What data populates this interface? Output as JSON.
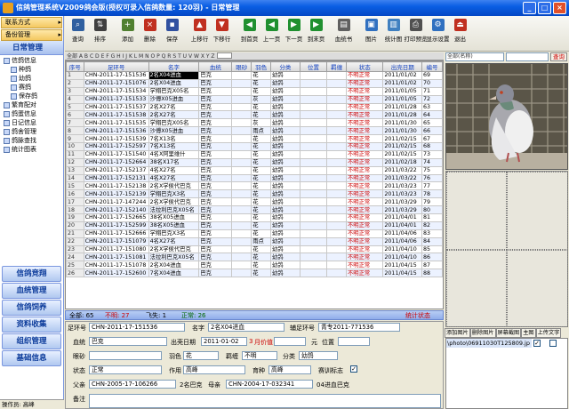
{
  "window": {
    "title": "信鸽管理系统V2009鸽会版(授权可录入信鸽数量: 120羽)  - 日常管理"
  },
  "nav": {
    "top_items": [
      {
        "label": "联系方式",
        "arrow": "▸"
      },
      {
        "label": "备份管理",
        "arrow": "▸"
      }
    ],
    "daily_section": "日常管理",
    "tree": [
      {
        "label": "信鸽信息",
        "sub": false
      },
      {
        "label": "种鸽",
        "sub": true
      },
      {
        "label": "幼鸽",
        "sub": true
      },
      {
        "label": "赛鸽",
        "sub": true
      },
      {
        "label": "保存鸽",
        "sub": true
      },
      {
        "label": "繁育配对",
        "sub": false
      },
      {
        "label": "鸽蛋信息",
        "sub": false
      },
      {
        "label": "日记信息",
        "sub": false
      },
      {
        "label": "鸽舍管理",
        "sub": false
      },
      {
        "label": "鸽脉查找",
        "sub": false
      },
      {
        "label": "统计图表",
        "sub": false
      }
    ],
    "sections": [
      "信鸽竞翔",
      "血统管理",
      "信鸽饲养",
      "资料收集",
      "组织管理",
      "基础信息"
    ],
    "status": "操作员: 高峰"
  },
  "toolbar": {
    "buttons": [
      {
        "label": "查询",
        "icon": "search-icon",
        "color": "#3060a0"
      },
      {
        "label": "排序",
        "icon": "sort-icon",
        "color": "#404040"
      },
      {
        "label": "添加",
        "icon": "add-icon",
        "color": "#508030"
      },
      {
        "label": "删除",
        "icon": "delete-icon",
        "color": "#c03020"
      },
      {
        "label": "保存",
        "icon": "save-icon",
        "color": "#3050a0"
      },
      {
        "label": "上移行",
        "icon": "move-up-icon",
        "color": "#c03020"
      },
      {
        "label": "下移行",
        "icon": "move-down-icon",
        "color": "#c03020"
      },
      {
        "label": "到首页",
        "icon": "first-page-icon",
        "color": "#209030"
      },
      {
        "label": "上一页",
        "icon": "prev-page-icon",
        "color": "#209030"
      },
      {
        "label": "下一页",
        "icon": "next-page-icon",
        "color": "#209030"
      },
      {
        "label": "到末页",
        "icon": "last-page-icon",
        "color": "#209030"
      },
      {
        "label": "血统书",
        "icon": "pedigree-icon",
        "color": "#606060"
      },
      {
        "label": "图片",
        "icon": "picture-icon",
        "color": "#3070c0"
      },
      {
        "label": "统计图",
        "icon": "chart-icon",
        "color": "#4080c0"
      },
      {
        "label": "打印预览",
        "icon": "print-preview-icon",
        "color": "#505050"
      },
      {
        "label": "显示设置",
        "icon": "display-settings-icon",
        "color": "#3070c0"
      },
      {
        "label": "退出",
        "icon": "exit-icon",
        "color": "#c03020"
      }
    ]
  },
  "alpha_bar": {
    "text": "全部 A B C D E F G H I J K L M N O P Q R S T U V W X Y Z"
  },
  "grid": {
    "columns": [
      "序号",
      "足环号",
      "名字",
      "血统",
      "眼砂",
      "羽色",
      "分类",
      "位置",
      "羁缠",
      "状态",
      "出壳日期",
      "编号"
    ],
    "rows": [
      [
        "1",
        "CHN-2011-17-151536",
        "2名X04进血",
        "巴克",
        "",
        "花",
        "幼鸽",
        "",
        "",
        "不明正常",
        "2011/01/02",
        "69"
      ],
      [
        "2",
        "CHN-2011-17-151076",
        "2名X04进血",
        "巴克",
        "",
        "花",
        "幼鸽",
        "",
        "",
        "不明正常",
        "2011/01/02",
        "70"
      ],
      [
        "3",
        "CHN-2011-17-151534",
        "学翔巴克X05名",
        "巴克",
        "",
        "花",
        "幼鸽",
        "",
        "",
        "不明正常",
        "2011/01/05",
        "71"
      ],
      [
        "4",
        "CHN-2011-17-151533",
        "沙傅X05进血",
        "巴克",
        "",
        "灰",
        "幼鸽",
        "",
        "",
        "不明正常",
        "2011/01/05",
        "72"
      ],
      [
        "5",
        "CHN-2011-17-151537",
        "2名X27名",
        "巴克",
        "",
        "花",
        "幼鸽",
        "",
        "",
        "不明正常",
        "2011/01/28",
        "63"
      ],
      [
        "6",
        "CHN-2011-17-151538",
        "2名X27名",
        "巴克",
        "",
        "花",
        "幼鸽",
        "",
        "",
        "不明正常",
        "2011/01/28",
        "64"
      ],
      [
        "7",
        "CHN-2011-17-151535",
        "学翔巴克X05名",
        "巴克",
        "",
        "灰",
        "幼鸽",
        "",
        "",
        "不明正常",
        "2011/01/30",
        "65"
      ],
      [
        "8",
        "CHN-2011-17-151536",
        "沙傅X05进血",
        "巴克",
        "",
        "雨点",
        "幼鸽",
        "",
        "",
        "不明正常",
        "2011/01/30",
        "66"
      ],
      [
        "9",
        "CHN-2011-17-151539",
        "7名X13名",
        "巴克",
        "",
        "花",
        "幼鸽",
        "",
        "",
        "不明正常",
        "2011/02/15",
        "67"
      ],
      [
        "10",
        "CHN-2011-17-152597",
        "7名X13名",
        "巴克",
        "",
        "花",
        "幼鸽",
        "",
        "",
        "不明正常",
        "2011/02/15",
        "68"
      ],
      [
        "11",
        "CHN-2011-17-151540",
        "4名X阿里维什",
        "巴克",
        "",
        "花",
        "幼鸽",
        "",
        "",
        "不明正常",
        "2011/02/15",
        "73"
      ],
      [
        "12",
        "CHN-2011-17-152664",
        "38名X17名",
        "巴克",
        "",
        "花",
        "幼鸽",
        "",
        "",
        "不明正常",
        "2011/02/18",
        "74"
      ],
      [
        "13",
        "CHN-2011-17-152137",
        "4名X27名",
        "巴克",
        "",
        "花",
        "幼鸽",
        "",
        "",
        "不明正常",
        "2011/03/22",
        "75"
      ],
      [
        "14",
        "CHN-2011-17-152131",
        "4名X27名",
        "巴克",
        "",
        "花",
        "幼鸽",
        "",
        "",
        "不明正常",
        "2011/03/22",
        "76"
      ],
      [
        "15",
        "CHN-2011-17-152138",
        "2名X学侯代巴克",
        "巴克",
        "",
        "花",
        "幼鸽",
        "",
        "",
        "不明正常",
        "2011/03/23",
        "77"
      ],
      [
        "16",
        "CHN-2011-17-152139",
        "学翔巴克X3名",
        "巴克",
        "",
        "花",
        "幼鸽",
        "",
        "",
        "不明正常",
        "2011/03/23",
        "78"
      ],
      [
        "17",
        "CHN-2011-17-147244",
        "2名X学侯代巴克",
        "巴克",
        "",
        "花",
        "幼鸽",
        "",
        "",
        "不明正常",
        "2011/03/29",
        "79"
      ],
      [
        "18",
        "CHN-2011-17-152140",
        "法拉利巴克X05名",
        "巴克",
        "",
        "花",
        "幼鸽",
        "",
        "",
        "不明正常",
        "2011/03/29",
        "80"
      ],
      [
        "19",
        "CHN-2011-17-152665",
        "38名X05进血",
        "巴克",
        "",
        "花",
        "幼鸽",
        "",
        "",
        "不明正常",
        "2011/04/01",
        "81"
      ],
      [
        "20",
        "CHN-2011-17-152599",
        "38名X05进血",
        "巴克",
        "",
        "花",
        "幼鸽",
        "",
        "",
        "不明正常",
        "2011/04/01",
        "82"
      ],
      [
        "21",
        "CHN-2011-17-152666",
        "学翔巴克X3名",
        "巴克",
        "",
        "花",
        "幼鸽",
        "",
        "",
        "不明正常",
        "2011/04/06",
        "83"
      ],
      [
        "22",
        "CHN-2011-17-151079",
        "4名X27名",
        "巴克",
        "",
        "雨点",
        "幼鸽",
        "",
        "",
        "不明正常",
        "2011/04/06",
        "84"
      ],
      [
        "23",
        "CHN-2011-17-151080",
        "2名X学侯代巴克",
        "巴克",
        "",
        "花",
        "幼鸽",
        "",
        "",
        "不明正常",
        "2011/04/10",
        "85"
      ],
      [
        "24",
        "CHN-2011-17-151081",
        "法拉利巴克X05名",
        "巴克",
        "",
        "花",
        "幼鸽",
        "",
        "",
        "不明正常",
        "2011/04/10",
        "86"
      ],
      [
        "25",
        "CHN-2011-17-151078",
        "2名X04进血",
        "巴克",
        "",
        "花",
        "幼鸽",
        "",
        "",
        "不明正常",
        "2011/04/15",
        "87"
      ],
      [
        "26",
        "CHN-2011-17-152600",
        "7名X04进血",
        "巴克",
        "",
        "花",
        "幼鸽",
        "",
        "",
        "不明正常",
        "2011/04/15",
        "88"
      ]
    ]
  },
  "summary": {
    "total": "全部: 65",
    "unknown": "不明: 27",
    "lost": "飞失: 1",
    "normal": "正常: 26",
    "status_btn": "统计状态"
  },
  "detail": {
    "ring_label": "足环号",
    "ring_value": "CHN-2011-17-151536",
    "name_label": "名字",
    "name_value": "2名X04进血",
    "aux_ring_label": "辅足环号",
    "aux_ring_value": "青专2011-771536",
    "blood_label": "血统",
    "blood_value": "巴克",
    "hatch_label": "出壳日期",
    "hatch_value": "2011-01-02",
    "age_value": "3",
    "age_unit": "月价值",
    "price_unit": "元",
    "pos_label": "位置",
    "eye_label": "眼砂",
    "feather_label": "羽色",
    "feather_value": "花",
    "gender_label": "羁缠",
    "gender_value": "不明",
    "class_label": "分类",
    "class_value": "幼鸽",
    "status_label": "状态",
    "status_value": "正常",
    "author_label": "作用",
    "author_value": "高峰",
    "breeder_label": "育种",
    "breeder_value": "高峰",
    "race_label": "赛训标志",
    "race_check": "✓",
    "father_label": "父亲",
    "father_value": "CHN-2005-17-106266",
    "father_name": "2名巴克",
    "mother_label": "母亲",
    "mother_value": "CHN-2004-17-032341",
    "mother_name": "04进血巴克",
    "note_label": "备注"
  },
  "right": {
    "select_value": "全部(名称)",
    "query_btn": "查询",
    "photo_btns": [
      "添加图片",
      "删除图片",
      "屏幕截图",
      "主图",
      "上传文字"
    ],
    "photo_path": "\\photo\\06911030T125809.jp",
    "photo_main": "✓"
  }
}
